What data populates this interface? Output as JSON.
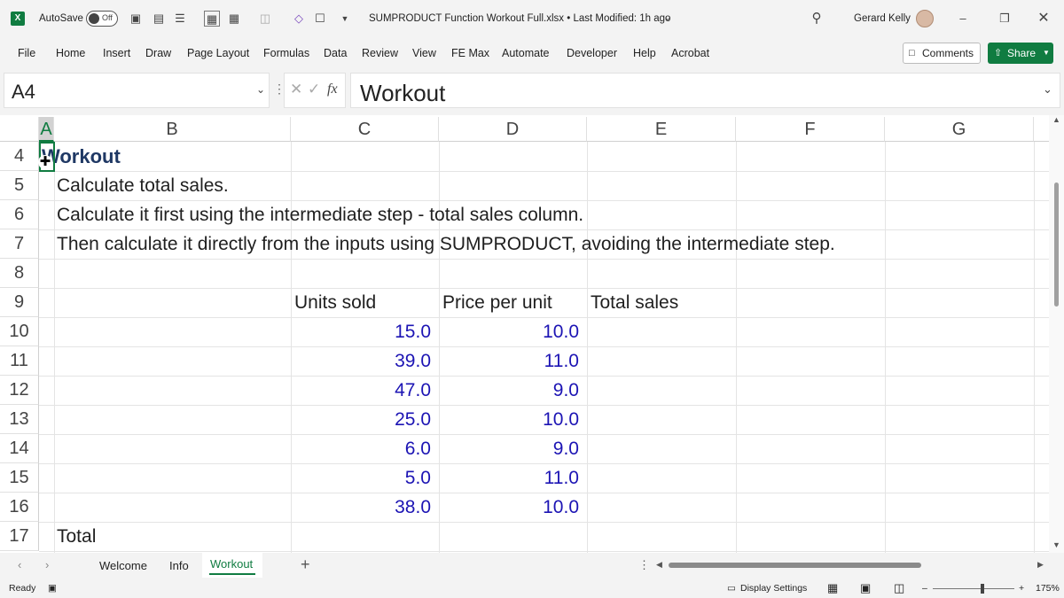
{
  "titlebar": {
    "app_icon": "X",
    "autosave_label": "AutoSave",
    "autosave_state": "Off",
    "doc_title": "SUMPRODUCT Function Workout Full.xlsx • Last Modified: 1h ago",
    "user_name": "Gerard Kelly"
  },
  "menu": {
    "items": [
      "File",
      "Home",
      "Insert",
      "Draw",
      "Page Layout",
      "Formulas",
      "Data",
      "Review",
      "View",
      "FE Max",
      "Automate",
      "Developer",
      "Help",
      "Acrobat"
    ],
    "comments_label": "Comments",
    "share_label": "Share"
  },
  "formula_bar": {
    "name_box": "A4",
    "fx_label": "fx",
    "formula": "Workout"
  },
  "grid": {
    "columns": [
      "A",
      "B",
      "C",
      "D",
      "E",
      "F",
      "G"
    ],
    "rows": [
      "4",
      "5",
      "6",
      "7",
      "8",
      "9",
      "10",
      "11",
      "12",
      "13",
      "14",
      "15",
      "16",
      "17"
    ],
    "cells": {
      "a4": "Workout",
      "b5": "Calculate total sales.",
      "b6": "Calculate it first using the intermediate step - total sales column.",
      "b7": "Then calculate it directly from the inputs using SUMPRODUCT, avoiding the intermediate step.",
      "c9": "Units sold",
      "d9": "Price per unit",
      "e9": "Total sales",
      "b17": "Total"
    },
    "units_sold": [
      "15.0",
      "39.0",
      "47.0",
      "25.0",
      "6.0",
      "5.0",
      "38.0"
    ],
    "price_per_unit": [
      "10.0",
      "11.0",
      "9.0",
      "10.0",
      "9.0",
      "11.0",
      "10.0"
    ]
  },
  "sheet_tabs": {
    "tabs": [
      "Welcome",
      "Info",
      "Workout"
    ],
    "active": "Workout",
    "add_label": "+"
  },
  "status": {
    "state": "Ready",
    "display_settings": "Display Settings",
    "zoom": "175%"
  },
  "colors": {
    "excel_green": "#107c41",
    "input_blue": "#1c14b4",
    "heading_navy": "#1f3864"
  }
}
